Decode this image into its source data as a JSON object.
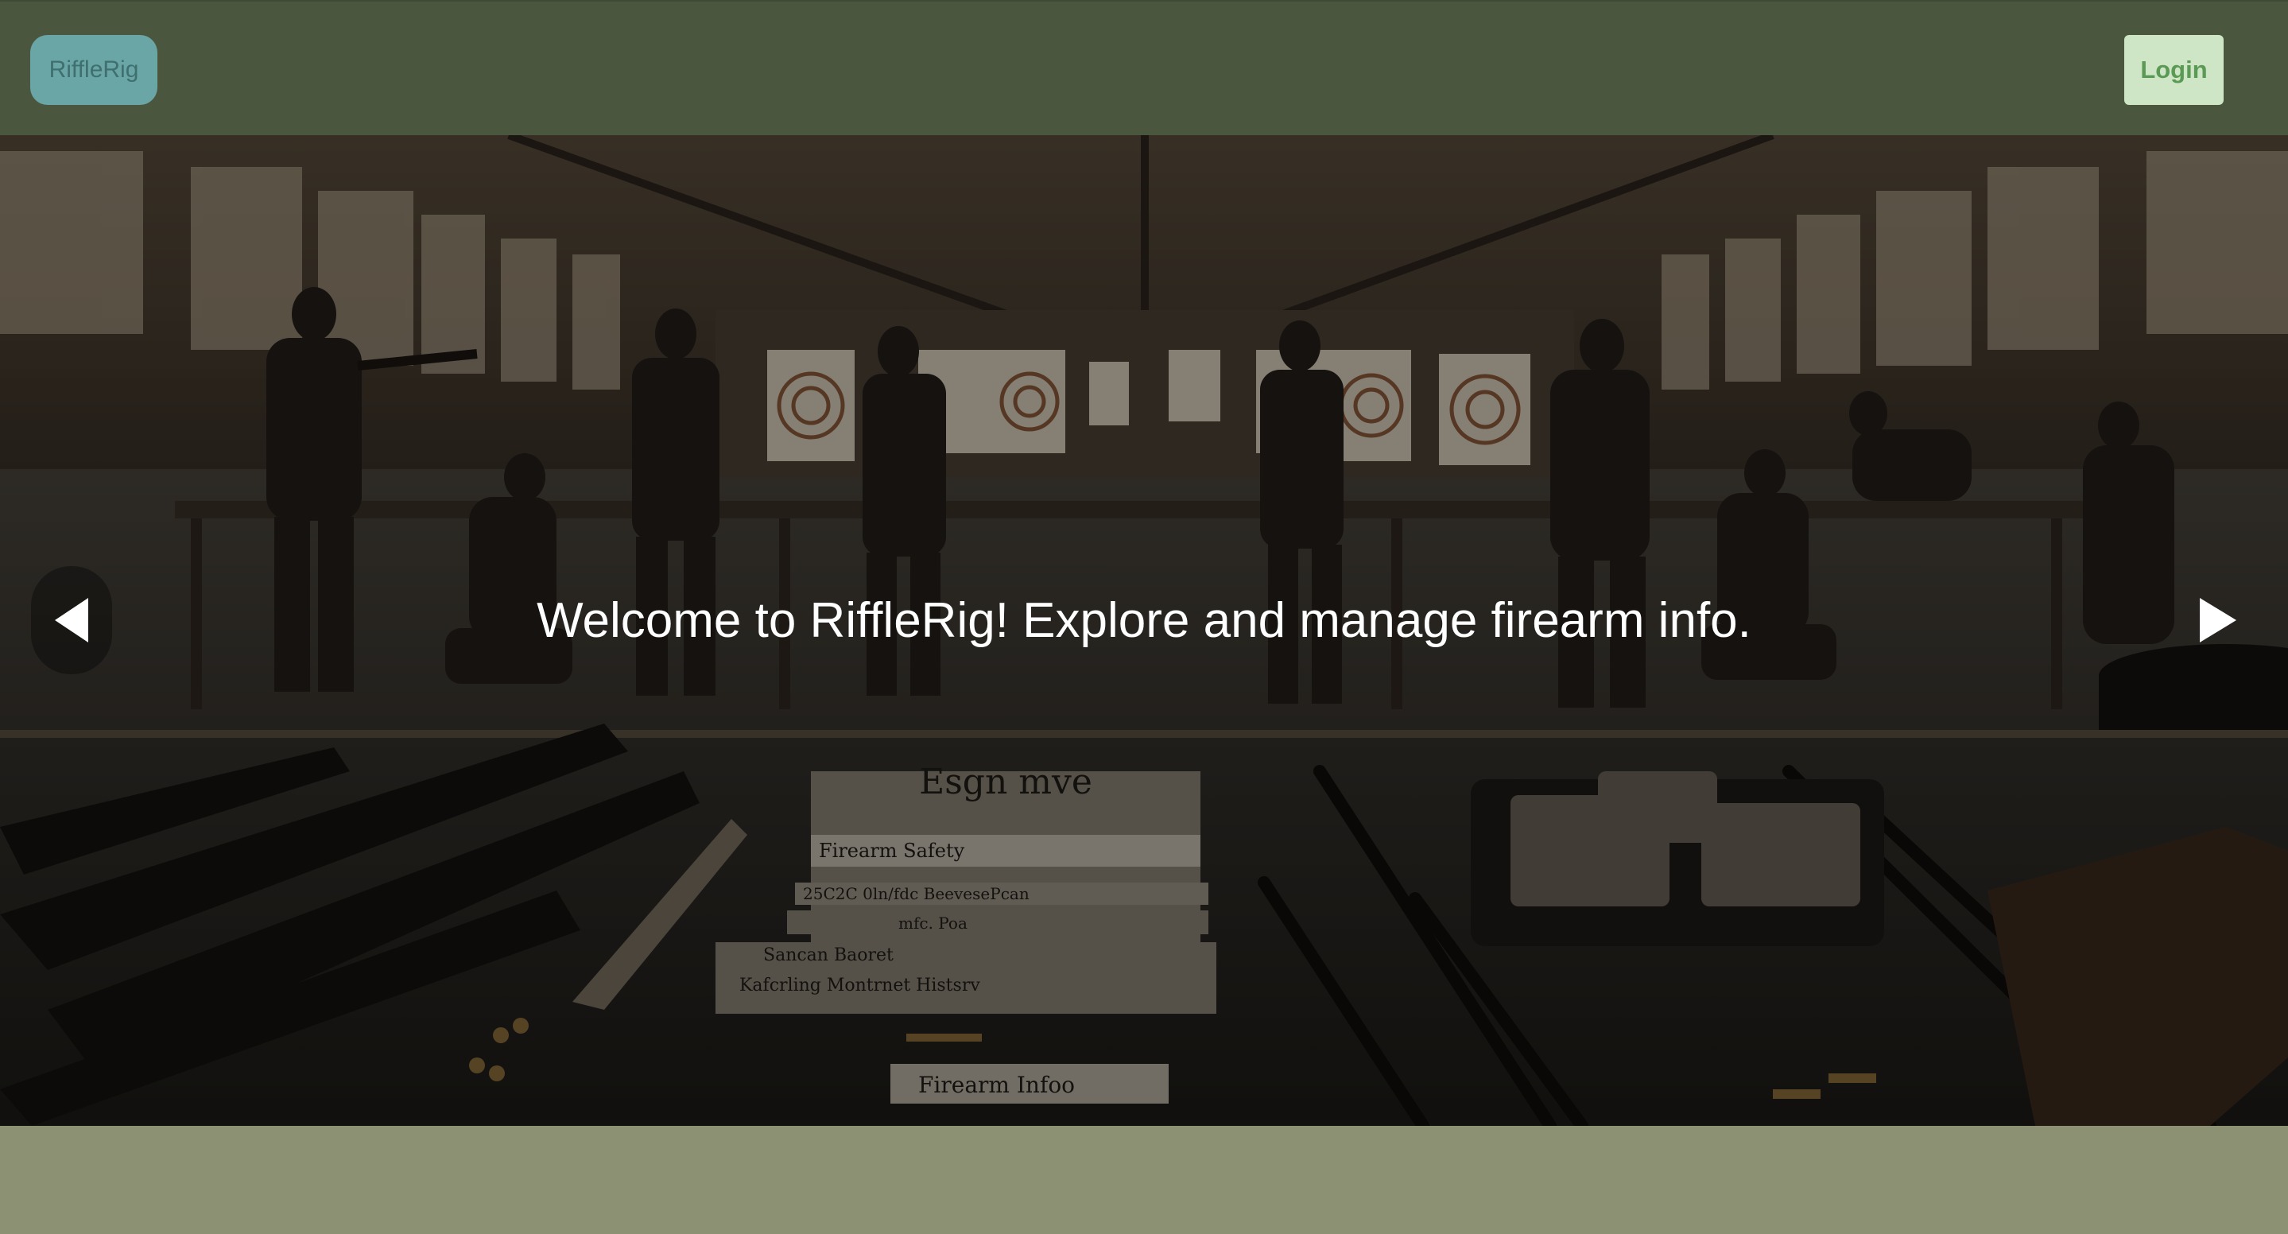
{
  "header": {
    "logo_label": "RiffleRig",
    "login_label": "Login"
  },
  "hero": {
    "caption": "Welcome to RiffleRig! Explore and manage firearm info.",
    "prev_icon": "triangle-left-icon",
    "next_icon": "triangle-right-icon",
    "image_text": {
      "sign_title": "Esgn mve",
      "line1": "Firearm Safety",
      "line2": "25C2C 0ln/fdc BeevesePcan",
      "line3": "mfc. Poa",
      "line4": "Sancan Baoret",
      "line5": "Kafcrling Montrnet Histsrv",
      "line6": "Firearm Infoo"
    }
  },
  "colors": {
    "header_bg": "#4a563e",
    "logo_bg": "#6aa6a6",
    "login_bg": "#cfe6c6",
    "page_bg": "#8c9174"
  }
}
